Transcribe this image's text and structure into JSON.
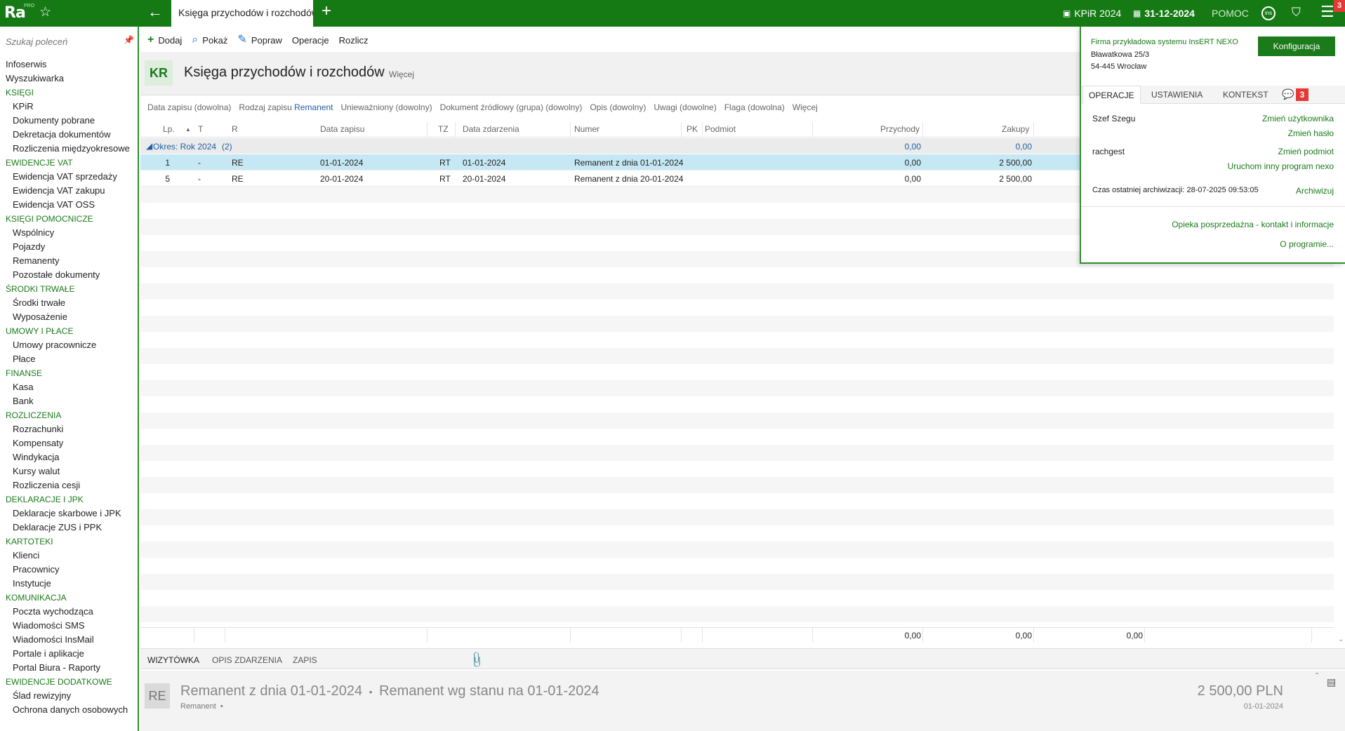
{
  "topbar": {
    "logo": "Ra",
    "logo_sup": "PRO",
    "active_tab": "Księga przychodów i rozchodów",
    "kpir_label": "KPiR 2024",
    "date_label": "31-12-2024",
    "help_label": "POMOC",
    "round_icon_text": "ins",
    "menu_badge": "3"
  },
  "sidebar": {
    "search_placeholder": "Szukaj poleceń",
    "items": [
      {
        "type": "top",
        "label": "Infoserwis"
      },
      {
        "type": "top",
        "label": "Wyszukiwarka"
      },
      {
        "type": "sec",
        "label": "KSIĘGI"
      },
      {
        "type": "sub",
        "label": "KPiR"
      },
      {
        "type": "sub",
        "label": "Dokumenty pobrane"
      },
      {
        "type": "sub",
        "label": "Dekretacja dokumentów"
      },
      {
        "type": "sub",
        "label": "Rozliczenia międzyokresowe"
      },
      {
        "type": "sec",
        "label": "EWIDENCJE VAT"
      },
      {
        "type": "sub",
        "label": "Ewidencja VAT sprzedaży"
      },
      {
        "type": "sub",
        "label": "Ewidencja VAT zakupu"
      },
      {
        "type": "sub",
        "label": "Ewidencja VAT OSS"
      },
      {
        "type": "sec",
        "label": "KSIĘGI POMOCNICZE"
      },
      {
        "type": "sub",
        "label": "Wspólnicy"
      },
      {
        "type": "sub",
        "label": "Pojazdy"
      },
      {
        "type": "sub",
        "label": "Remanenty"
      },
      {
        "type": "sub",
        "label": "Pozostałe dokumenty"
      },
      {
        "type": "sec",
        "label": "ŚRODKI TRWAŁE"
      },
      {
        "type": "sub",
        "label": "Środki trwałe"
      },
      {
        "type": "sub",
        "label": "Wyposażenie"
      },
      {
        "type": "sec",
        "label": "UMOWY I PŁACE"
      },
      {
        "type": "sub",
        "label": "Umowy pracownicze"
      },
      {
        "type": "sub",
        "label": "Płace"
      },
      {
        "type": "sec",
        "label": "FINANSE"
      },
      {
        "type": "sub",
        "label": "Kasa"
      },
      {
        "type": "sub",
        "label": "Bank"
      },
      {
        "type": "sec",
        "label": "ROZLICZENIA"
      },
      {
        "type": "sub",
        "label": "Rozrachunki"
      },
      {
        "type": "sub",
        "label": "Kompensaty"
      },
      {
        "type": "sub",
        "label": "Windykacja"
      },
      {
        "type": "sub",
        "label": "Kursy walut"
      },
      {
        "type": "sub",
        "label": "Rozliczenia cesji"
      },
      {
        "type": "sec",
        "label": "DEKLARACJE I JPK"
      },
      {
        "type": "sub",
        "label": "Deklaracje skarbowe i JPK"
      },
      {
        "type": "sub",
        "label": "Deklaracje ZUS i PPK"
      },
      {
        "type": "sec",
        "label": "KARTOTEKI"
      },
      {
        "type": "sub",
        "label": "Klienci"
      },
      {
        "type": "sub",
        "label": "Pracownicy"
      },
      {
        "type": "sub",
        "label": "Instytucje"
      },
      {
        "type": "sec",
        "label": "KOMUNIKACJA"
      },
      {
        "type": "sub",
        "label": "Poczta wychodząca"
      },
      {
        "type": "sub",
        "label": "Wiadomości SMS"
      },
      {
        "type": "sub",
        "label": "Wiadomości InsMail"
      },
      {
        "type": "sub",
        "label": "Portale i aplikacje"
      },
      {
        "type": "sub",
        "label": "Portal Biura - Raporty"
      },
      {
        "type": "sec",
        "label": "EWIDENCJE DODATKOWE"
      },
      {
        "type": "sub",
        "label": "Ślad rewizyjny"
      },
      {
        "type": "sub",
        "label": "Ochrona danych osobowych"
      }
    ]
  },
  "toolbar": {
    "add": "Dodaj",
    "show": "Pokaż",
    "edit": "Popraw",
    "operations": "Operacje",
    "settle": "Rozlicz"
  },
  "header": {
    "badge": "KR",
    "title": "Księga przychodów i rozchodów",
    "more": "Więcej"
  },
  "filters": {
    "date": "Data zapisu (dowolna)",
    "type_label": "Rodzaj zapisu",
    "type_value": "Remanent",
    "cancelled": "Unieważniony (dowolny)",
    "source": "Dokument źródłowy (grupa) (dowolny)",
    "description": "Opis (dowolny)",
    "notes": "Uwagi (dowolne)",
    "flag": "Flaga (dowolna)",
    "more": "Więcej"
  },
  "table": {
    "columns": {
      "lp": "Lp.",
      "t": "T",
      "r": "R",
      "data_zapisu": "Data zapisu",
      "tz": "TZ",
      "data_zdarzenia": "Data zdarzenia",
      "numer": "Numer",
      "pk": "PK",
      "podmiot": "Podmiot",
      "przychody": "Przychody",
      "zakupy": "Zakupy"
    },
    "group": {
      "label": "Okres: Rok 2024",
      "count": "(2)",
      "przychody": "0,00",
      "zakupy": "0,00"
    },
    "rows": [
      {
        "lp": "1",
        "t": "-",
        "r": "RE",
        "data_zapisu": "01-01-2024",
        "tz": "RT",
        "data_zdarzenia": "01-01-2024",
        "numer": "Remanent z dnia 01-01-2024",
        "przychody": "0,00",
        "zakupy": "2 500,00"
      },
      {
        "lp": "5",
        "t": "-",
        "r": "RE",
        "data_zapisu": "20-01-2024",
        "tz": "RT",
        "data_zdarzenia": "20-01-2024",
        "numer": "Remanent z dnia 20-01-2024",
        "przychody": "0,00",
        "zakupy": "2 500,00"
      }
    ],
    "totals": {
      "przychody": "0,00",
      "zakupy": "0,00",
      "extra": "0,00"
    }
  },
  "bottom_tabs": {
    "card": "WIZYTÓWKA",
    "event": "OPIS ZDARZENIA",
    "entry": "ZAPIS"
  },
  "detail": {
    "badge": "RE",
    "title": "Remanent z dnia 01-01-2024",
    "separator": "•",
    "title2": "Remanent wg stanu na 01-01-2024",
    "sub": "Remanent",
    "sub_dot": "•",
    "amount": "2 500,00 PLN",
    "date": "01-01-2024"
  },
  "panel": {
    "firm_name": "Firma przykładowa systemu InsERT NEXO",
    "addr1": "Bławatkowa 25/3",
    "addr2": "54-445 Wrocław",
    "config_button": "Konfiguracja",
    "tabs": [
      "OPERACJE",
      "USTAWIENIA",
      "KONTEKST"
    ],
    "chat_badge": "3",
    "user": "Szef Szegu",
    "change_user": "Zmień użytkownika",
    "change_password": "Zmień hasło",
    "entity": "rachgest",
    "change_entity": "Zmień podmiot",
    "run_other": "Uruchom inny program nexo",
    "archive_label": "Czas ostatniej archiwizacji: 28-07-2025 09:53:05",
    "archive_link": "Archiwizuj",
    "support_link": "Opieka posprzedażna - kontakt i informacje",
    "about_link": "O programie..."
  }
}
